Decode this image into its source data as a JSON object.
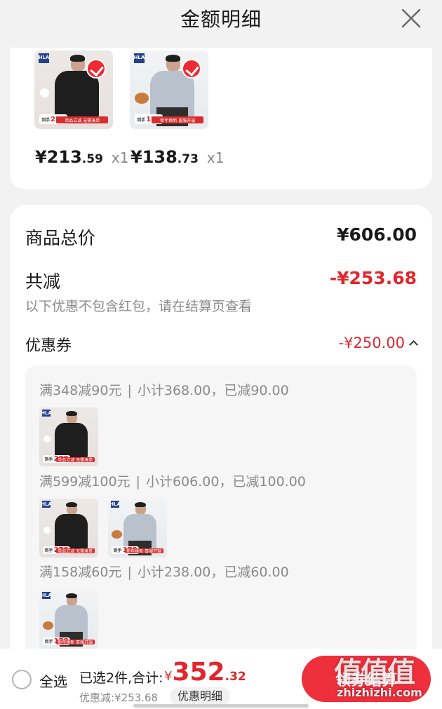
{
  "header": {
    "title": "金额明细",
    "close_icon": "close-icon"
  },
  "products": [
    {
      "price_int": "¥213",
      "price_dec": ".59",
      "qty": "x1",
      "tag_price": "278",
      "banner": "单品立减 无需凑单",
      "selected": true
    },
    {
      "price_int": "¥138",
      "price_dec": ".73",
      "qty": "x1",
      "tag_price": "178",
      "banner": "新年换新 喜服开端",
      "selected": true
    }
  ],
  "summary": {
    "total_label": "商品总价",
    "total_value": "¥606.00",
    "reduce_label": "共减",
    "reduce_value": "-¥253.68",
    "reduce_note": "以下优惠不包含红包，请在结算页查看",
    "coupon_label": "优惠券",
    "coupon_value": "-¥250.00"
  },
  "coupons": [
    {
      "rule": "满348减90元",
      "detail": "小计368.00，已减90.00"
    },
    {
      "rule": "满599减100元",
      "detail": "小计606.00，已减100.00"
    },
    {
      "rule": "满158减60元",
      "detail": "小计238.00，已减60.00"
    }
  ],
  "bottom": {
    "select_all": "全选",
    "selected_info": "已选2件,合计:",
    "currency": "¥",
    "amount_int": "352",
    "amount_dec": ".32",
    "discount_info": "优惠减:¥253.68",
    "detail_pill": "优惠明细",
    "checkout": "领券结算"
  },
  "watermark": {
    "big": "值值值",
    "small": "zhizhizhi.com"
  },
  "colors": {
    "accent": "#ee2f3c",
    "price_red": "#e1262d",
    "muted": "#8a8a8a"
  }
}
